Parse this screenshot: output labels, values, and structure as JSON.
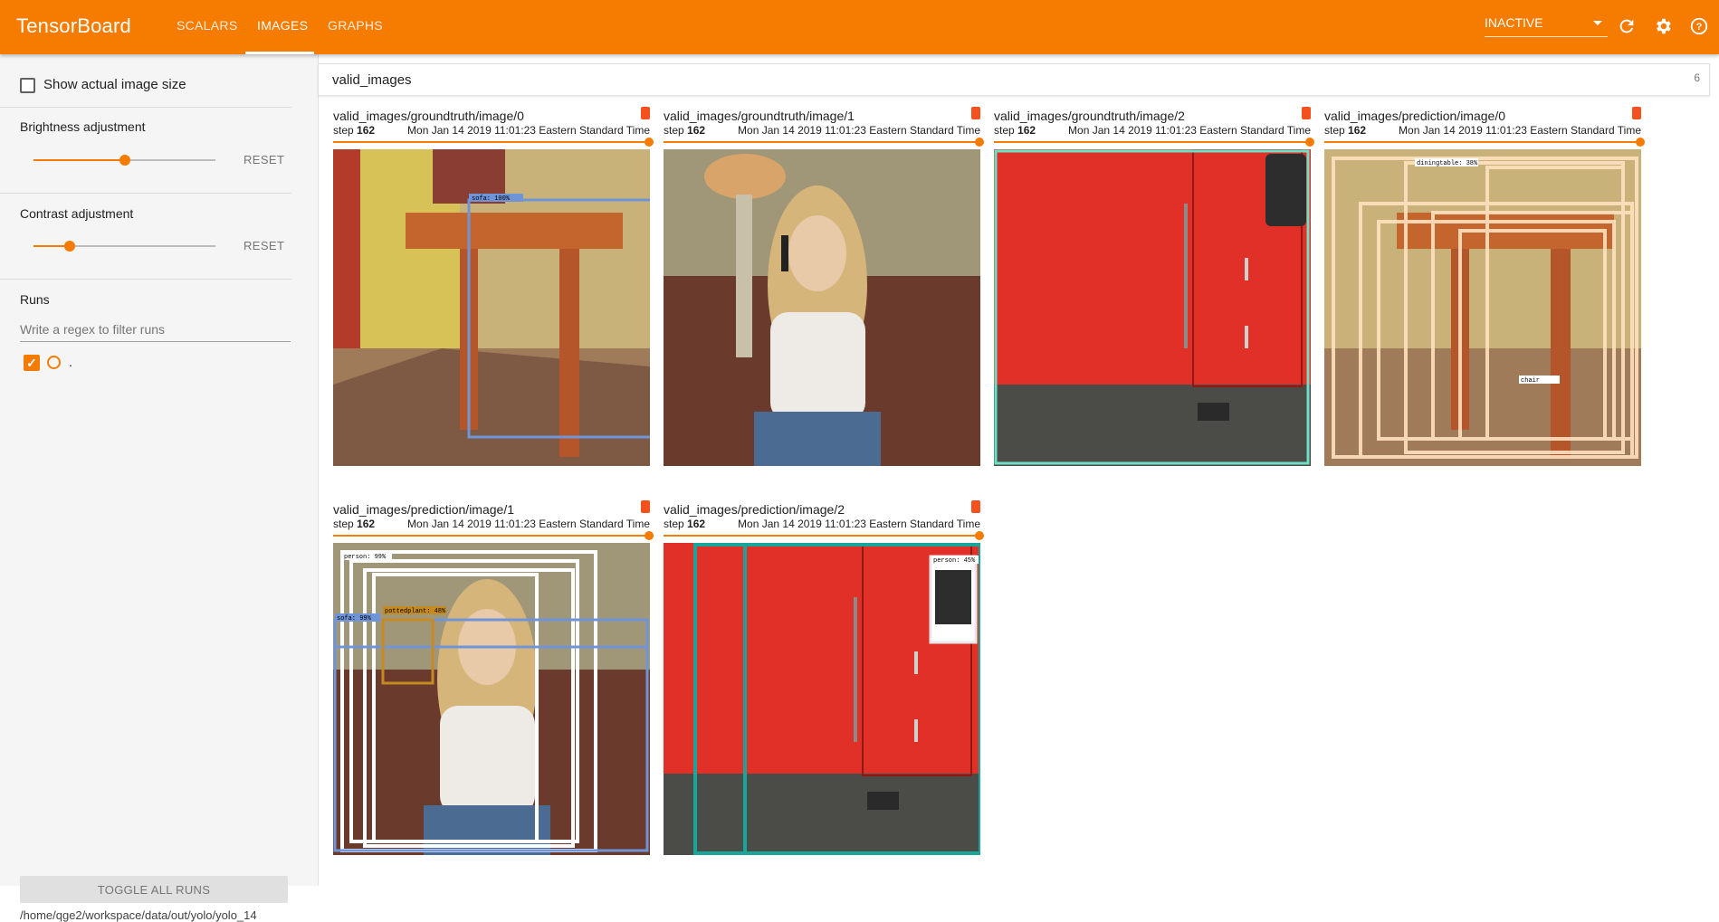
{
  "app": {
    "title": "TensorBoard"
  },
  "nav": {
    "tabs": [
      "SCALARS",
      "IMAGES",
      "GRAPHS"
    ],
    "active": "IMAGES"
  },
  "toolbar": {
    "run_selector": "INACTIVE",
    "icons": [
      "refresh-icon",
      "settings-icon",
      "help-icon"
    ]
  },
  "sidebar": {
    "show_actual_size": "Show actual image size",
    "brightness": {
      "label": "Brightness adjustment",
      "reset": "RESET",
      "value": 0.5
    },
    "contrast": {
      "label": "Contrast adjustment",
      "reset": "RESET",
      "value": 0.2
    },
    "runs": {
      "label": "Runs",
      "filter_placeholder": "Write a regex to filter runs",
      "items": [
        {
          "name": ".",
          "checked": true
        }
      ]
    },
    "toggle_all": "TOGGLE ALL RUNS",
    "logdir": "/home/qge2/workspace/data/out/yolo/yolo_14"
  },
  "category": {
    "name": "valid_images",
    "count": "6"
  },
  "cards": [
    {
      "title": "valid_images/groundtruth/image/0",
      "step_label": "step",
      "step": "162",
      "time": "Mon Jan 14 2019 11:01:23 Eastern Standard Time"
    },
    {
      "title": "valid_images/groundtruth/image/1",
      "step_label": "step",
      "step": "162",
      "time": "Mon Jan 14 2019 11:01:23 Eastern Standard Time"
    },
    {
      "title": "valid_images/groundtruth/image/2",
      "step_label": "step",
      "step": "162",
      "time": "Mon Jan 14 2019 11:01:23 Eastern Standard Time"
    },
    {
      "title": "valid_images/prediction/image/0",
      "step_label": "step",
      "step": "162",
      "time": "Mon Jan 14 2019 11:01:23 Eastern Standard Time"
    },
    {
      "title": "valid_images/prediction/image/1",
      "step_label": "step",
      "step": "162",
      "time": "Mon Jan 14 2019 11:01:23 Eastern Standard Time"
    },
    {
      "title": "valid_images/prediction/image/2",
      "step_label": "step",
      "step": "162",
      "time": "Mon Jan 14 2019 11:01:23 Eastern Standard Time"
    }
  ],
  "box_labels": {
    "sofa": "sofa: 100%",
    "chair": "chair",
    "diningtable": "diningtable: 38%",
    "person": "person: 99%",
    "sofa2": "sofa: 99%",
    "pottedplant": "pottedplant: 48%",
    "person2": "person: 45%"
  }
}
